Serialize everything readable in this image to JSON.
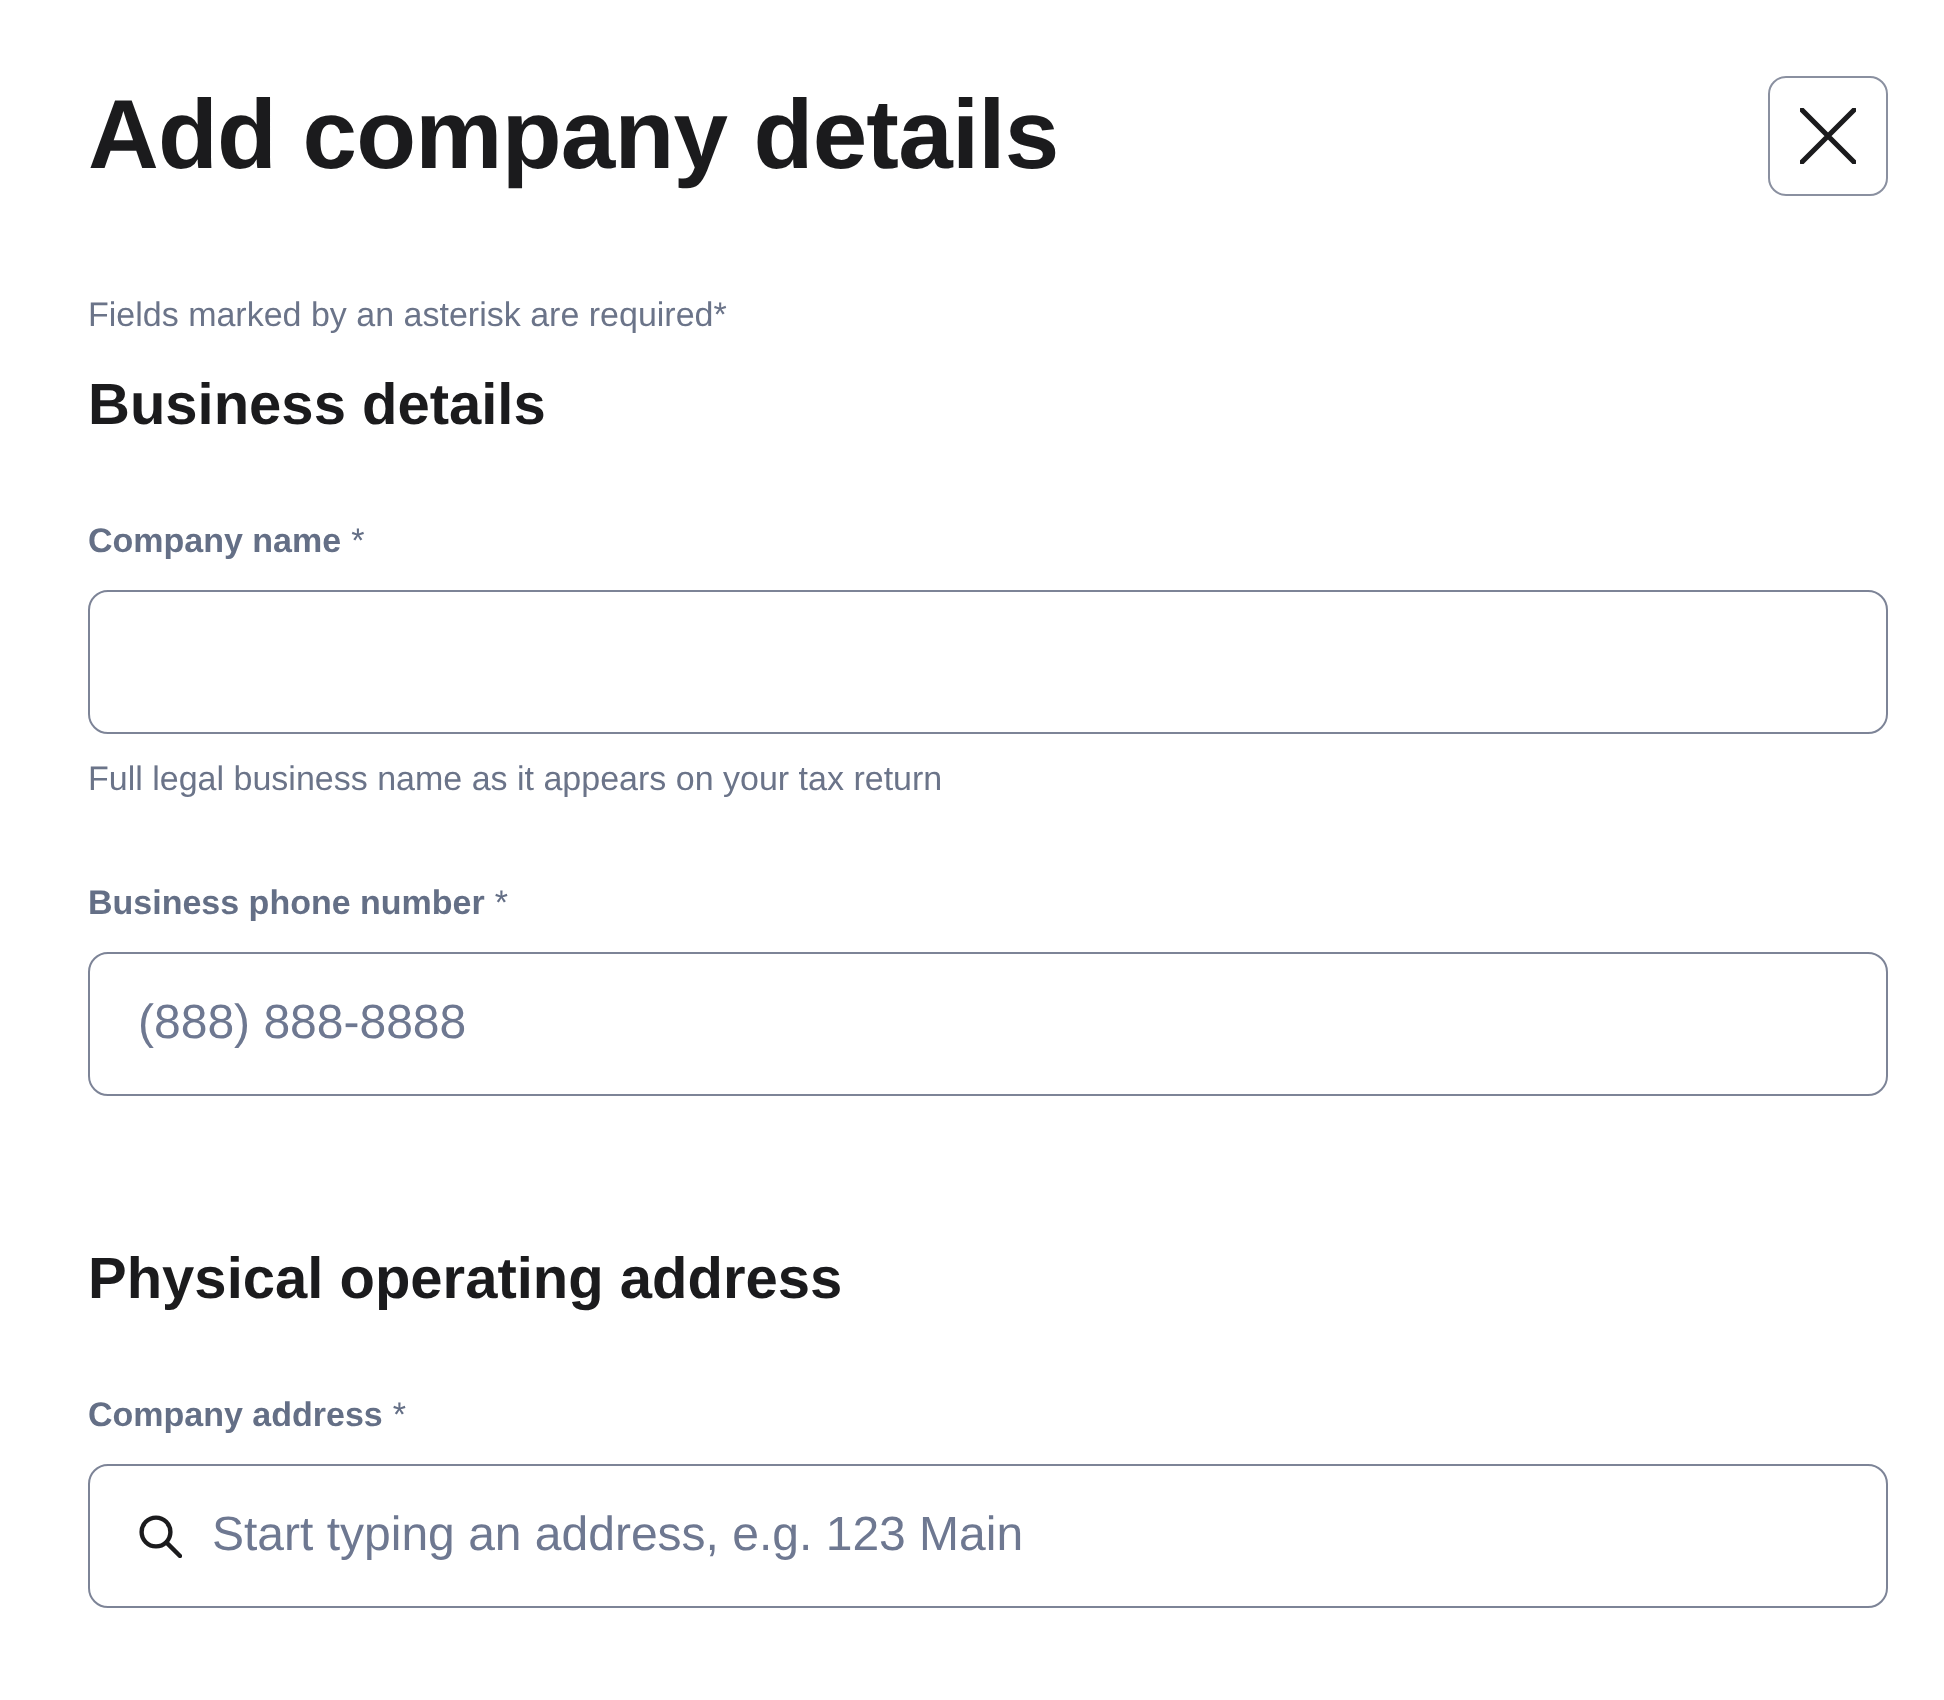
{
  "title": "Add company details",
  "required_note": "Fields marked by an asterisk are required*",
  "sections": [
    {
      "heading": "Business details",
      "fields": [
        {
          "kind": "text",
          "label": "Company name",
          "required_mark": "*",
          "hint": "Full legal business name as it appears on your tax return"
        },
        {
          "kind": "text",
          "label": "Business phone number",
          "required_mark": "*",
          "placeholder": "(888) 888-8888"
        }
      ]
    },
    {
      "heading": "Physical operating address",
      "fields": [
        {
          "kind": "search",
          "label": "Company address",
          "required_mark": "*",
          "placeholder": "Start typing an address, e.g. 123 Main"
        }
      ]
    }
  ]
}
